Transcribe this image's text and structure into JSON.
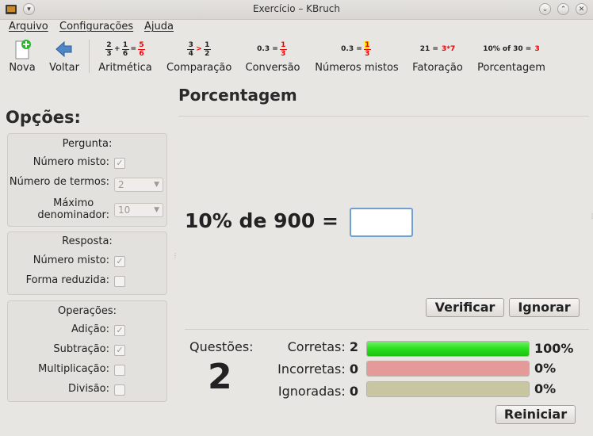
{
  "window": {
    "title": "Exercício – KBruch"
  },
  "menu": [
    "Arquivo",
    "Configurações",
    "Ajuda"
  ],
  "toolbar": {
    "new": "Nova",
    "back": "Voltar",
    "modes": [
      {
        "label": "Aritmética",
        "icon": "arithmetic-icon"
      },
      {
        "label": "Comparação",
        "icon": "comparison-icon"
      },
      {
        "label": "Conversão",
        "icon": "conversion-icon"
      },
      {
        "label": "Números mistos",
        "icon": "mixed-numbers-icon"
      },
      {
        "label": "Fatoração",
        "icon": "factorization-icon"
      },
      {
        "label": "Porcentagem",
        "icon": "percentage-icon"
      }
    ],
    "icon_text": {
      "conv_left": "0.3",
      "mixed_left": "0.3",
      "fact": "21 =",
      "fact_red": "3*7",
      "pct": "10% of 30 =",
      "pct_red": "3"
    }
  },
  "page_title": "Porcentagem",
  "options": {
    "title": "Opções:",
    "pergunta": {
      "title": "Pergunta:",
      "numero_misto": "Número misto:",
      "numero_termos": "Número de termos:",
      "numero_termos_value": "2",
      "maximo_line1": "Máximo",
      "maximo_line2": "denominador:",
      "maximo_value": "10"
    },
    "resposta": {
      "title": "Resposta:",
      "numero_misto": "Número misto:",
      "forma_reduzida": "Forma reduzida:"
    },
    "operacoes": {
      "title": "Operações:",
      "adicao": "Adição:",
      "subtracao": "Subtração:",
      "multiplicacao": "Multiplicação:",
      "divisao": "Divisão:"
    }
  },
  "exercise": {
    "question": "10% de 900 =",
    "answer": ""
  },
  "buttons": {
    "verify": "Verificar",
    "skip": "Ignorar",
    "reset": "Reiniciar"
  },
  "stats": {
    "questions_label": "Questões:",
    "questions_value": "2",
    "correct_label": "Corretas:",
    "correct_value": "2",
    "correct_pct": "100%",
    "correct_fraction": 1.0,
    "incorrect_label": "Incorretas:",
    "incorrect_value": "0",
    "incorrect_pct": "0%",
    "incorrect_fraction": 1.0,
    "skipped_label": "Ignoradas:",
    "skipped_value": "0",
    "skipped_pct": "0%",
    "skipped_fraction": 1.0
  },
  "colors": {
    "correct": "#28e01e",
    "incorrect": "#e59a9a",
    "skipped": "#c8c6a0",
    "accent_red": "#ee0000",
    "focus": "#6fa0d4"
  }
}
